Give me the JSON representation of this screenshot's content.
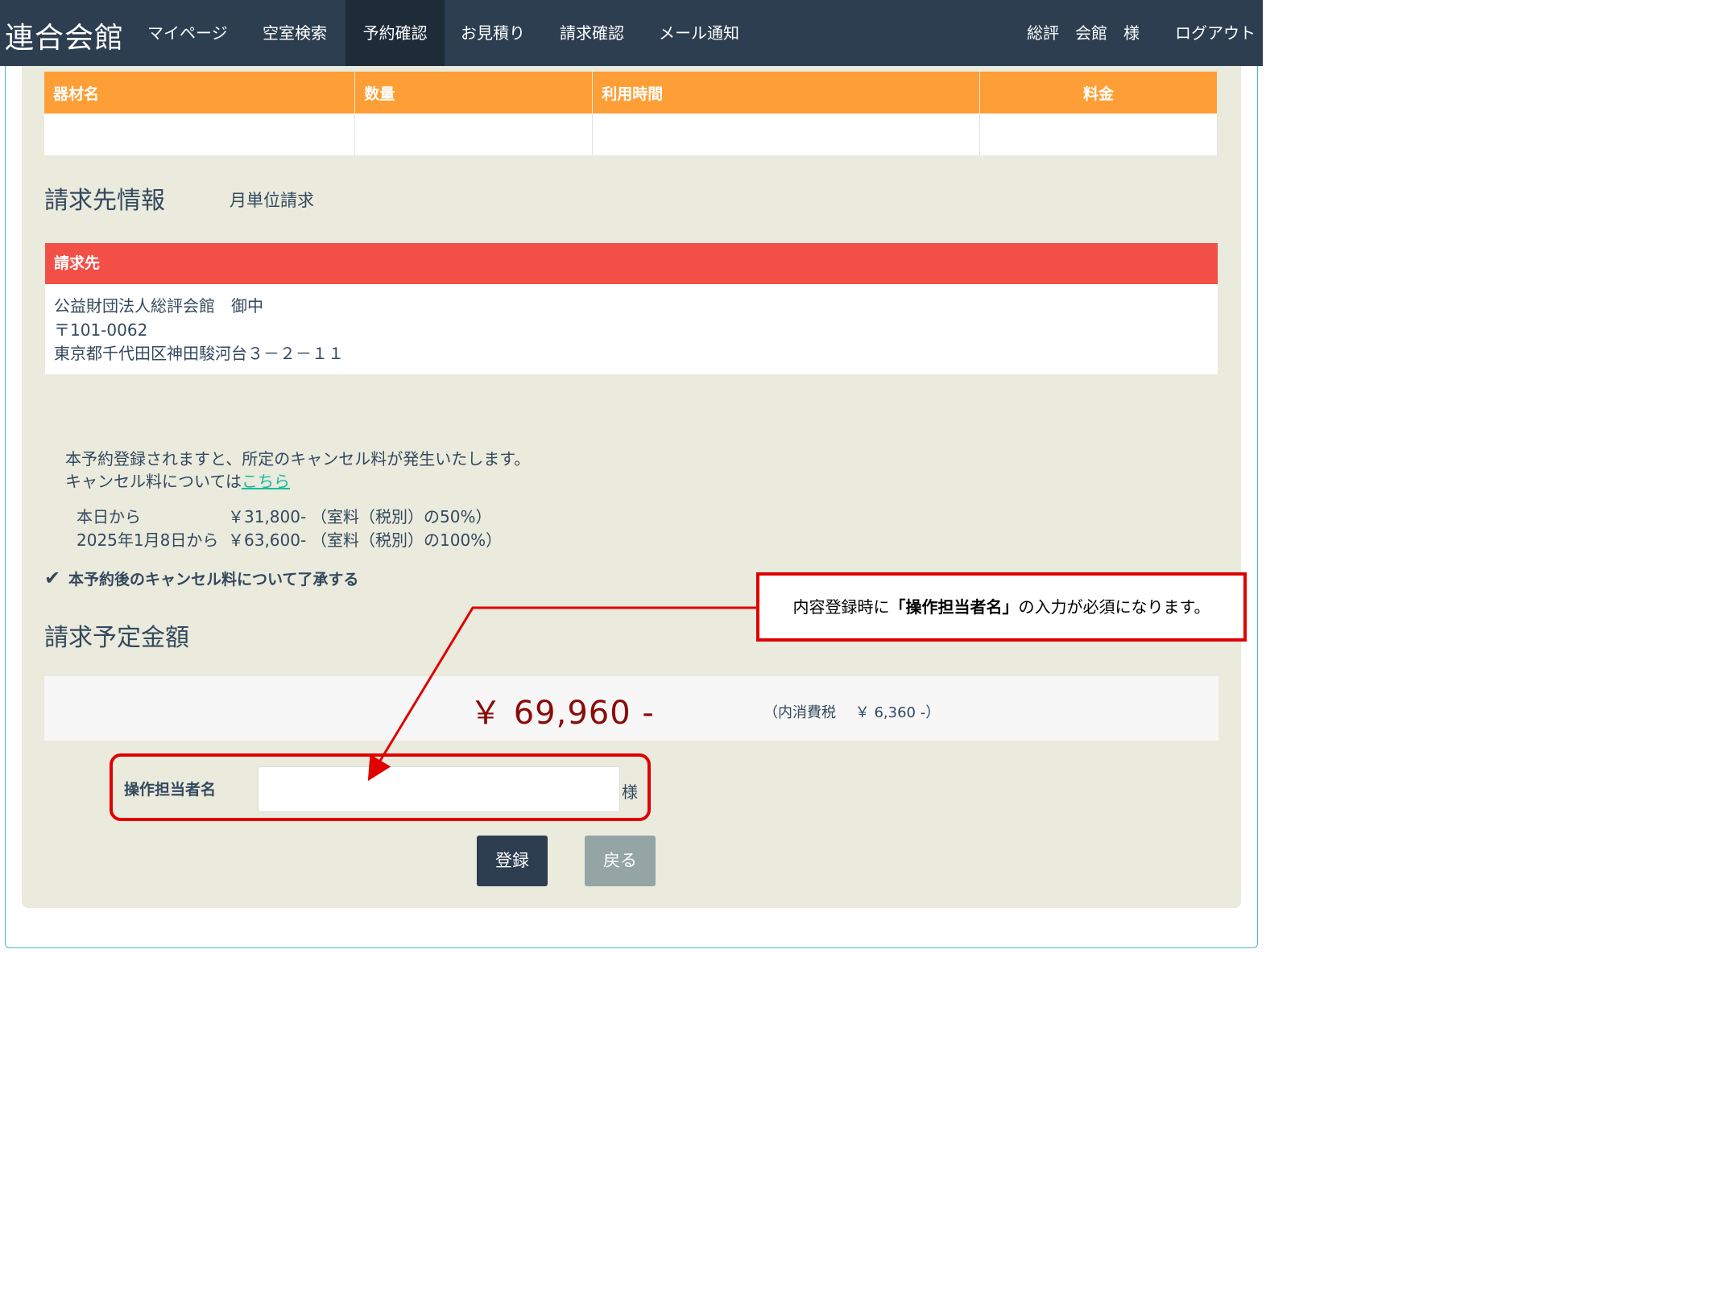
{
  "nav": {
    "brand": "連合会館",
    "items": [
      {
        "label": "マイページ"
      },
      {
        "label": "空室検索"
      },
      {
        "label": "予約確認"
      },
      {
        "label": "お見積り"
      },
      {
        "label": "請求確認"
      },
      {
        "label": "メール通知"
      }
    ],
    "user": "総評　会館　様",
    "logout": "ログアウト"
  },
  "equipment_table": {
    "headers": [
      "器材名",
      "数量",
      "利用時間",
      "料金"
    ]
  },
  "billing": {
    "section_title": "請求先情報",
    "billing_type": "月単位請求",
    "header": "請求先",
    "lines": [
      "公益財団法人総評会館　御中",
      "〒101-0062",
      "東京都千代田区神田駿河台３－２－１１"
    ]
  },
  "cancel": {
    "notice": "本予約登録されますと、所定のキャンセル料が発生いたします。",
    "link_prefix": "キャンセル料については",
    "link_text": "こちら",
    "rows": [
      {
        "from": "本日から",
        "amount": "￥31,800-",
        "note": "（室料（税別）の50%）"
      },
      {
        "from": "2025年1月8日から",
        "amount": "￥63,600-",
        "note": "（室料（税別）の100%）"
      }
    ],
    "agree_label": "本予約後のキャンセル料について了承する"
  },
  "amount": {
    "section_title": "請求予定金額",
    "total": "￥ 69,960 -",
    "tax": "（内消費税　 ￥ 6,360 -）"
  },
  "operator": {
    "label": "操作担当者名",
    "value": "",
    "suffix": "様"
  },
  "buttons": {
    "register": "登録",
    "back": "戻る"
  },
  "annotation": {
    "prefix": "内容登録時に",
    "emphasis": "「操作担当者名」",
    "suffix": "の入力が必須になります。"
  }
}
